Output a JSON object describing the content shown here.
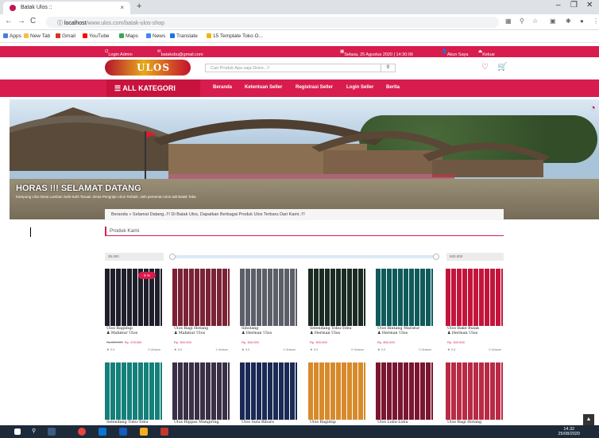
{
  "browser": {
    "tab_title": "Batak Ulos ::",
    "new_tab": "+",
    "url_host": "localhost",
    "url_path": "/www.ulos.com/batak-ulos-shop",
    "bookmarks": [
      "Apps",
      "New Tab",
      "Gmail",
      "YouTube",
      "Maps",
      "News",
      "Translate",
      "15 Template Toko O..."
    ]
  },
  "topbar": {
    "login_admin": "Login Admin",
    "email": "bataksbu@gmail.com",
    "datetime": "Selasa, 25 Agustus 2020 | 14:30:06",
    "account": "Akun Saya",
    "logout": "Keluar"
  },
  "header": {
    "logo_text": "ULOS",
    "search_placeholder": "Cari Produk Apa saja Disini...!!",
    "search_icon": "search-icon"
  },
  "nav": {
    "all_category": "ALL KATEGORI",
    "links": [
      "Beranda",
      "Ketentuan Seller",
      "Registrasi Seller",
      "Login Seller",
      "Berita"
    ]
  },
  "hero": {
    "title": "HORAS !!! SELAMAT DATANG",
    "subtitle": "Kampung Ulos Desa Lumban Suhi-Suhi Toruan. Desa Pengrajin Ulos Terbaik, oleh pemenan Ulos asli Batak Toba"
  },
  "breadcrumb": {
    "home": "Beranda",
    "sep": "»",
    "text": "Selamat Datang..!!! Di Batak Ulos, Dapatkan Berbagai Produk Ulos Terbaru Dari Kami..!!!"
  },
  "section_title": "Produk Kami",
  "price_filter": {
    "min": "35.000",
    "max": "500.000",
    "range_fraction": [
      0.0,
      1.0
    ]
  },
  "products_row1": [
    {
      "name": "Ulos Ragidup",
      "seller": "Mahmur Ulos",
      "old_price": "Rp.800.000",
      "price": "Rp. 478.000",
      "rating": "★ 0.0",
      "reviews": "0 Ulasan",
      "discount": "6 %",
      "color": "#1e1f2a"
    },
    {
      "name": "Ulos Ragi Hotang",
      "seller": "Mahmur Ulos",
      "old_price": "",
      "price": "Rp. 300.000",
      "rating": "★ 5.0",
      "reviews": "1 Ulasan",
      "discount": "",
      "color": "#7a2236"
    },
    {
      "name": "Sibolang",
      "seller": "Herman Ulos",
      "old_price": "",
      "price": "Rp. 300.000",
      "rating": "★ 4.0",
      "reviews": "1 Ulasan",
      "discount": "",
      "color": "#5c5f68"
    },
    {
      "name": "Selendang Tobu-Tobu",
      "seller": "Herman Ulos",
      "old_price": "",
      "price": "Rp. 300.000",
      "rating": "★ 0.0",
      "reviews": "0 Ulasan",
      "discount": "",
      "color": "#1b2b24"
    },
    {
      "name": "Ulos Bintang Maratur",
      "seller": "Herman Ulos",
      "old_price": "",
      "price": "Rp. 800.000",
      "rating": "★ 0.0",
      "reviews": "0 Ulasan",
      "discount": "",
      "color": "#0f5a5a"
    },
    {
      "name": "Ulos Bake Bulak",
      "seller": "Herman Ulos",
      "old_price": "",
      "price": "Rp. 300.000",
      "rating": "★ 0.0",
      "reviews": "0 Ulasan",
      "discount": "",
      "color": "#c3153c"
    }
  ],
  "products_row2": [
    {
      "name": "Selendang Tobu-Tobu",
      "color": "#157f7a"
    },
    {
      "name": "Ulos Hippas Mangiring",
      "color": "#3a2f45"
    },
    {
      "name": "Ulos Sulu Bibaro",
      "color": "#1a2a55"
    },
    {
      "name": "Ulos Ragidup",
      "color": "#d88a2b"
    },
    {
      "name": "Ulos Lobu-Lobu",
      "color": "#7a1630"
    },
    {
      "name": "Ulos Ragi Hotang",
      "color": "#b82a45"
    }
  ],
  "taskbar": {
    "time": "14.32",
    "date": "25/08/2020"
  }
}
